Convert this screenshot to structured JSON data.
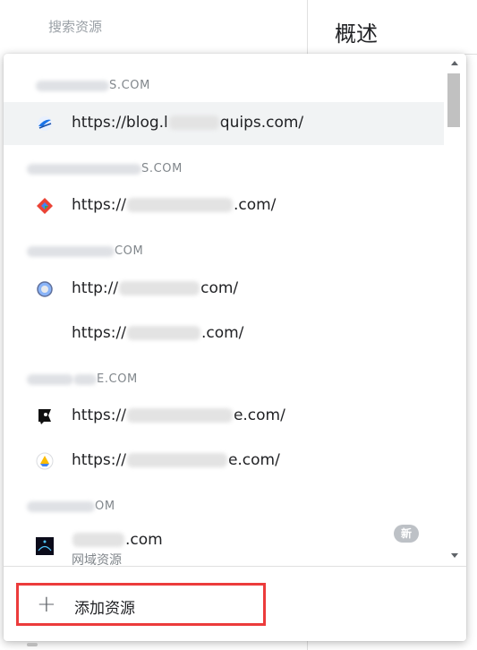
{
  "sidebar": {
    "search_placeholder": "搜索资源"
  },
  "main": {
    "title": "概述"
  },
  "dropdown": {
    "groups": [
      {
        "header": "S.COM"
      },
      {
        "header": "S.COM"
      },
      {
        "header": "COM"
      },
      {
        "header": "E.COM"
      },
      {
        "header": "OM"
      }
    ],
    "rows": [
      {
        "prefix": "https://blog.l",
        "suffix": "quips.com/",
        "icon": "bird-logo-icon"
      },
      {
        "prefix": "https://",
        "suffix": ".com/",
        "icon": "red-diamond-logo-icon"
      },
      {
        "prefix": "http://",
        "suffix": "com/",
        "icon": "globe-icon"
      },
      {
        "prefix": "https://",
        "suffix": ".com/",
        "icon": ""
      },
      {
        "prefix": "https://",
        "suffix": "e.com/",
        "icon": "black-flag-logo-icon"
      },
      {
        "prefix": "https://",
        "suffix": "e.com/",
        "icon": "drive-triangle-logo-icon"
      },
      {
        "prefix": "",
        "suffix": ".com",
        "icon": "dark-square-logo-icon",
        "sub": "网域资源",
        "badge": "新"
      }
    ],
    "add_label": "添加资源",
    "colors": {
      "highlight_border": "#ec3b3b",
      "active_row": "#f1f3f4"
    }
  }
}
